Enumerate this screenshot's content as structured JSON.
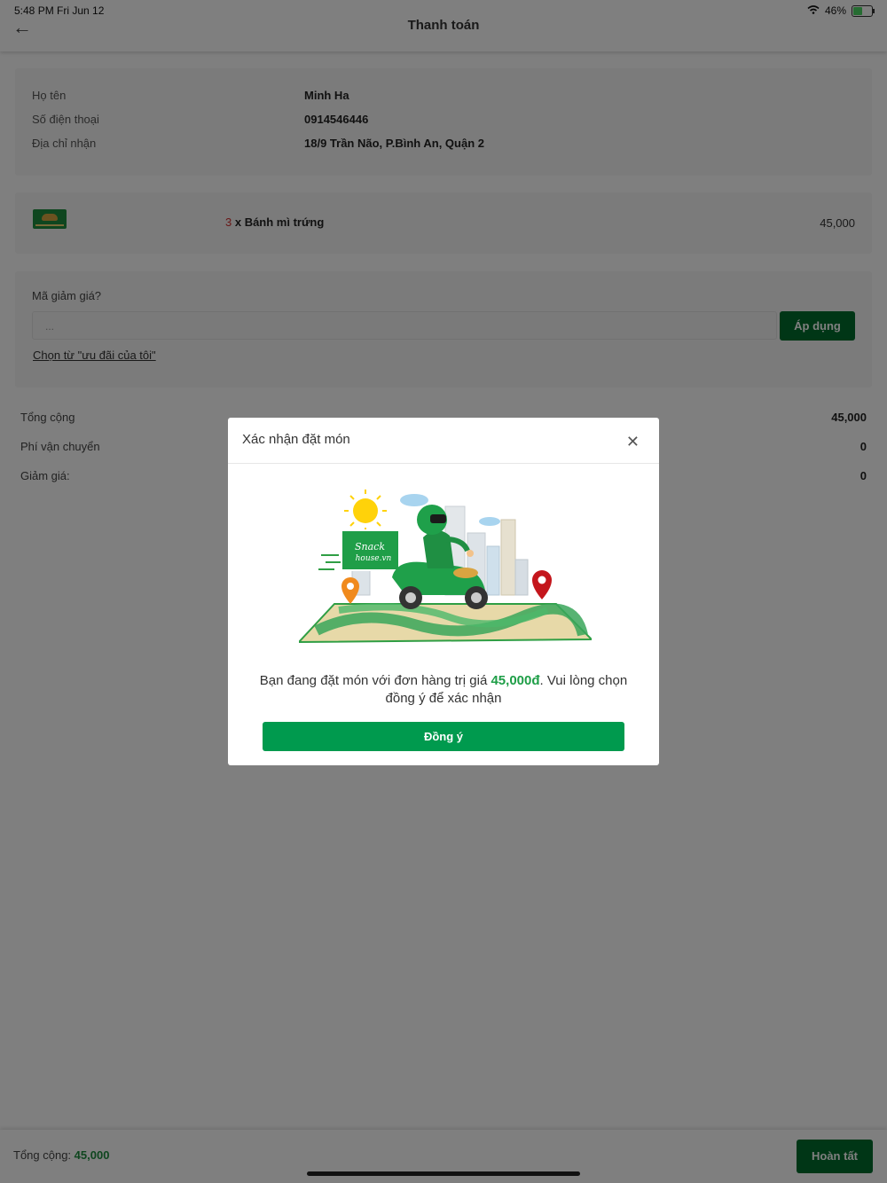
{
  "status_bar": {
    "time": "5:48 PM   Fri Jun 12",
    "battery": "46%"
  },
  "header": {
    "title": "Thanh toán"
  },
  "customer": {
    "rows": [
      {
        "label": "Họ tên",
        "value": "Minh Ha"
      },
      {
        "label": "Số điện thoại",
        "value": "0914546446"
      },
      {
        "label": "Địa chỉ nhận",
        "value": "18/9 Trần Não, P.Bình An, Quận 2"
      }
    ]
  },
  "order_item": {
    "qty": "3",
    "name": " x Bánh mì trứng",
    "price": "45,000"
  },
  "coupon": {
    "label": "Mã giảm giá?",
    "placeholder": "...",
    "apply_label": "Áp dụng",
    "link_label": "Chọn từ \"ưu đãi của tôi\""
  },
  "totals": [
    {
      "label": "Tổng cộng",
      "value": "45,000"
    },
    {
      "label": "Phí vận chuyển",
      "value": "0"
    },
    {
      "label": "Giảm giá:",
      "value": "0"
    }
  ],
  "footer": {
    "sum_label": "Tổng cộng: ",
    "sum_value": "45,000",
    "done_label": "Hoàn tất"
  },
  "modal": {
    "title": "Xác nhận đặt món",
    "message_prefix": "Bạn đang đặt món với đơn hàng trị giá ",
    "amount": "45,000đ",
    "message_suffix": ". Vui lòng chọn đồng ý để xác nhận",
    "confirm_label": "Đồng ý",
    "logo_text": "Snack house.vn"
  },
  "colors": {
    "brand_green": "#006d2c",
    "accent_green": "#009a4e",
    "amount_green": "#1e9e47",
    "qty_red": "#d32f2f"
  }
}
